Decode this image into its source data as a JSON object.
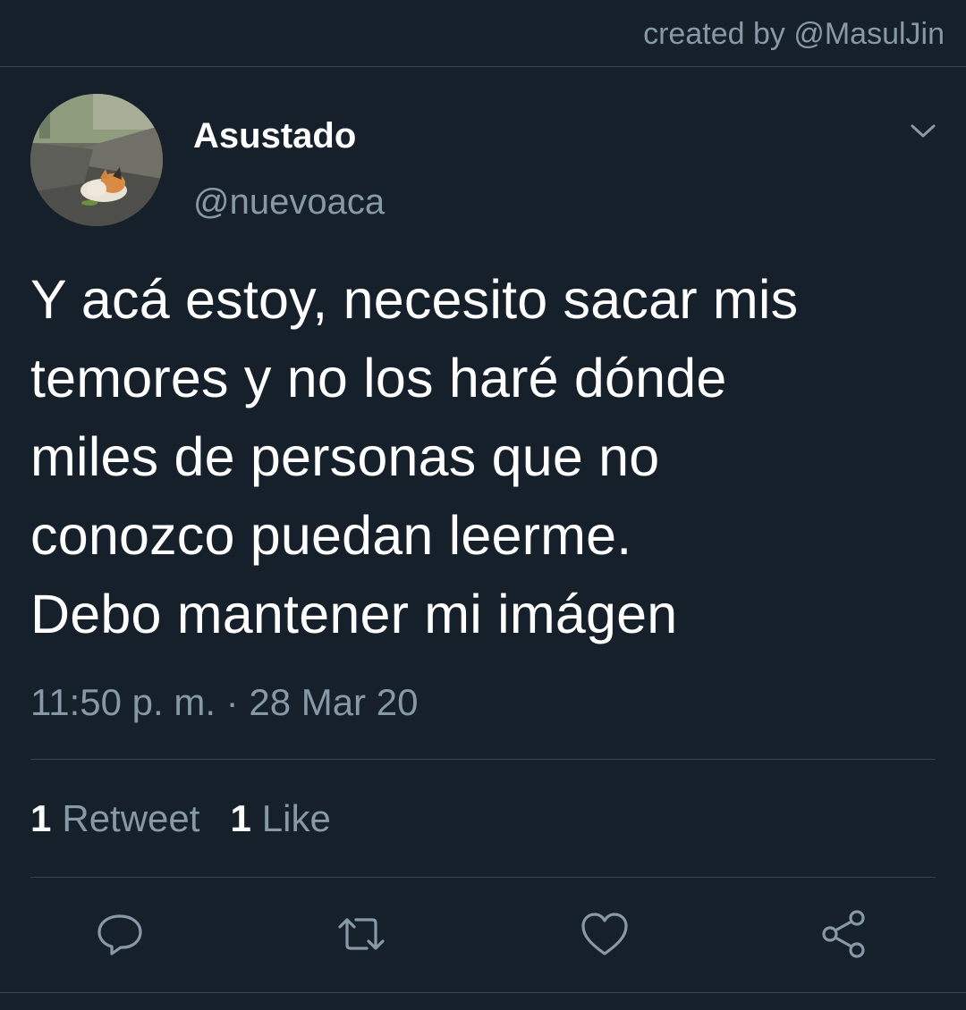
{
  "watermark": "created by @MasulJin",
  "tweet": {
    "display_name": "Asustado",
    "handle": "@nuevoaca",
    "text": "Y acá estoy, necesito sacar mis\ntemores y no los haré dónde\nmiles de personas que no\nconozco puedan leerme.\nDebo mantener mi imágen",
    "timestamp": "11:50 p. m. · 28 Mar 20",
    "retweets": {
      "count": "1",
      "label": "Retweet"
    },
    "likes": {
      "count": "1",
      "label": "Like"
    }
  },
  "icons": {
    "menu": "chevron-down-icon",
    "reply": "reply-icon",
    "retweet": "retweet-icon",
    "like": "heart-icon",
    "share": "share-icon"
  },
  "colors": {
    "background": "#15202b",
    "secondary_text": "#8899a6",
    "divider": "#38444d"
  }
}
